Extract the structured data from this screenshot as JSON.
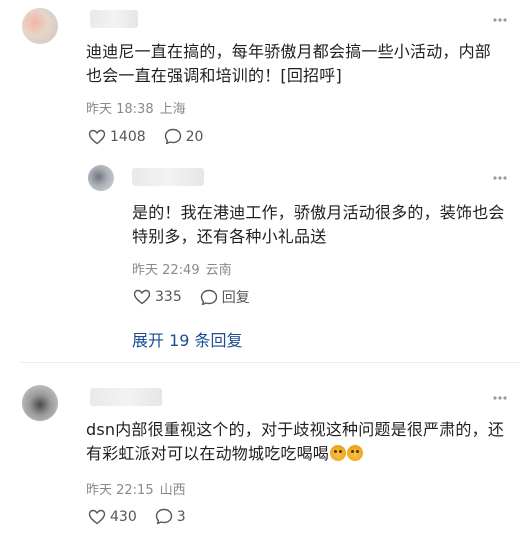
{
  "comments": [
    {
      "text": "迪迪尼一直在搞的，每年骄傲月都会搞一些小活动，内部也会一直在强调和培训的！[回招呼]",
      "time": "昨天 18:38",
      "location": "上海",
      "likes": "1408",
      "replies": "20"
    },
    {
      "text": "是的！我在港迪工作，骄傲月活动很多的，装饰也会特别多，还有各种小礼品送",
      "time": "昨天 22:49",
      "location": "云南",
      "likes": "335",
      "reply_label": "回复"
    },
    {
      "text": "dsn内部很重视这个的，对于歧视这种问题是很严肃的，还有彩虹派对可以在动物城吃吃喝喝",
      "time": "昨天 22:15",
      "location": "山西",
      "likes": "430",
      "replies": "3"
    }
  ],
  "expand_label": "展开 19 条回复",
  "icons": {
    "more": "more-dots-icon",
    "like": "heart-icon",
    "comment": "comment-bubble-icon",
    "emoji": "smiling-face-emoji"
  },
  "colors": {
    "link": "#1a4e91",
    "meta": "#8a8a8a",
    "text": "#1f1f1f"
  }
}
